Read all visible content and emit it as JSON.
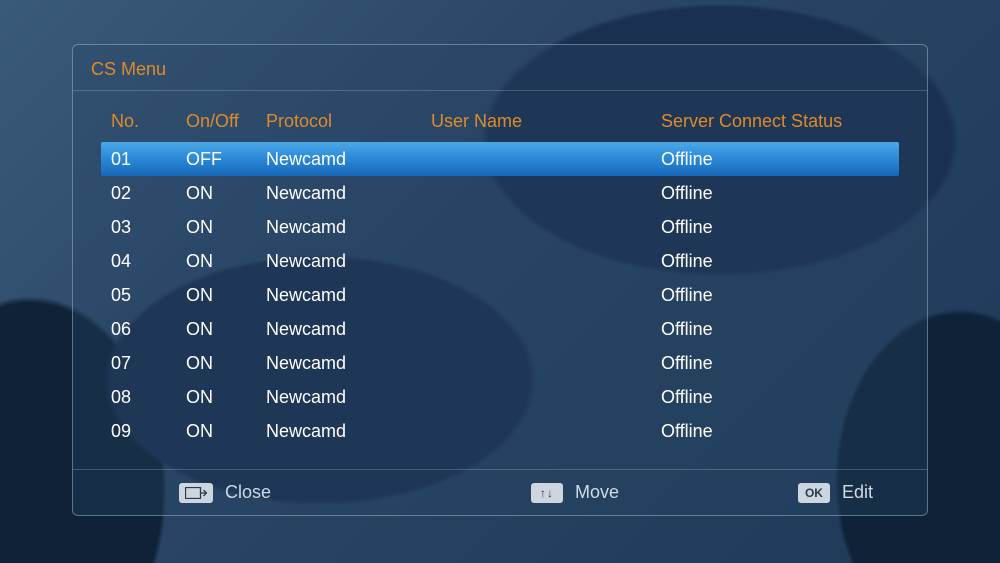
{
  "title": "CS Menu",
  "headers": {
    "no": "No.",
    "onoff": "On/Off",
    "protocol": "Protocol",
    "user": "User Name",
    "status": "Server Connect Status"
  },
  "rows": [
    {
      "no": "01",
      "onoff": "OFF",
      "protocol": "Newcamd",
      "user": "",
      "status": "Offline",
      "selected": true
    },
    {
      "no": "02",
      "onoff": "ON",
      "protocol": "Newcamd",
      "user": "",
      "status": "Offline",
      "selected": false
    },
    {
      "no": "03",
      "onoff": "ON",
      "protocol": "Newcamd",
      "user": "",
      "status": "Offline",
      "selected": false
    },
    {
      "no": "04",
      "onoff": "ON",
      "protocol": "Newcamd",
      "user": "",
      "status": "Offline",
      "selected": false
    },
    {
      "no": "05",
      "onoff": "ON",
      "protocol": "Newcamd",
      "user": "",
      "status": "Offline",
      "selected": false
    },
    {
      "no": "06",
      "onoff": "ON",
      "protocol": "Newcamd",
      "user": "",
      "status": "Offline",
      "selected": false
    },
    {
      "no": "07",
      "onoff": "ON",
      "protocol": "Newcamd",
      "user": "",
      "status": "Offline",
      "selected": false
    },
    {
      "no": "08",
      "onoff": "ON",
      "protocol": "Newcamd",
      "user": "",
      "status": "Offline",
      "selected": false
    },
    {
      "no": "09",
      "onoff": "ON",
      "protocol": "Newcamd",
      "user": "",
      "status": "Offline",
      "selected": false
    }
  ],
  "footer": {
    "close": {
      "key_glyph": "⎘",
      "label": "Close"
    },
    "move": {
      "key_glyph": "↑↓",
      "label": "Move"
    },
    "edit": {
      "key_glyph": "OK",
      "label": "Edit"
    }
  }
}
